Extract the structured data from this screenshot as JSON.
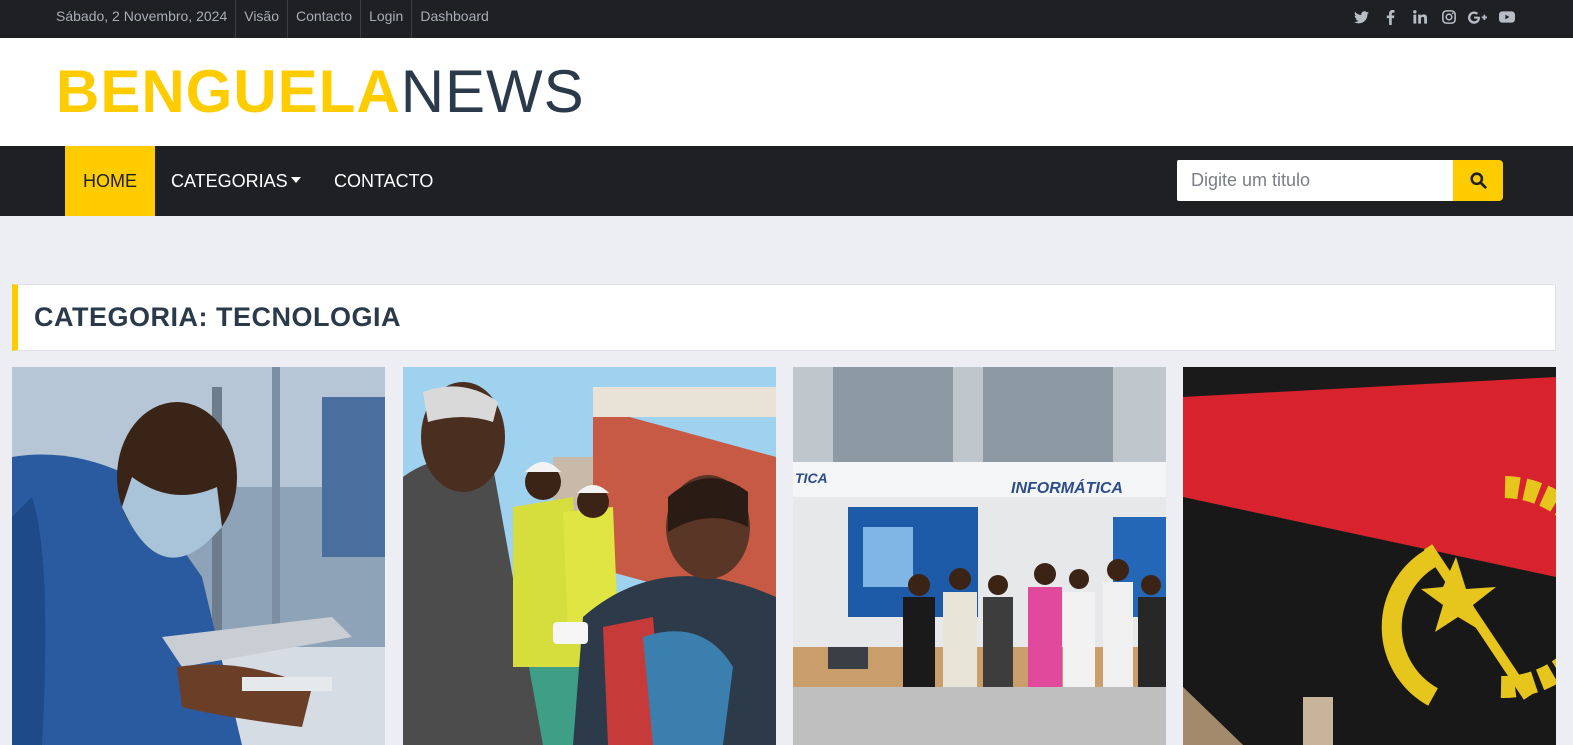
{
  "topbar": {
    "date": "Sábado, 2 Novembro, 2024",
    "links": [
      "Visão",
      "Contacto",
      "Login",
      "Dashboard"
    ],
    "social": [
      "twitter-icon",
      "facebook-icon",
      "linkedin-icon",
      "instagram-icon",
      "google-plus-icon",
      "youtube-icon"
    ]
  },
  "logo": {
    "part1": "BENGUELA",
    "part2": "NEWS"
  },
  "nav": {
    "home": "HOME",
    "categories": "CATEGORIAS",
    "contact": "CONTACTO",
    "search_placeholder": "Digite um titulo"
  },
  "page": {
    "heading": "CATEGORIA: TECNOLOGIA"
  },
  "cards": {
    "card3_sign": "INFORMÁTICA",
    "card3_sign_left": "TICA"
  },
  "colors": {
    "accent": "#ffcc00",
    "dark": "#1e2024",
    "navy": "#2b3a4a",
    "background": "#eceef3"
  }
}
